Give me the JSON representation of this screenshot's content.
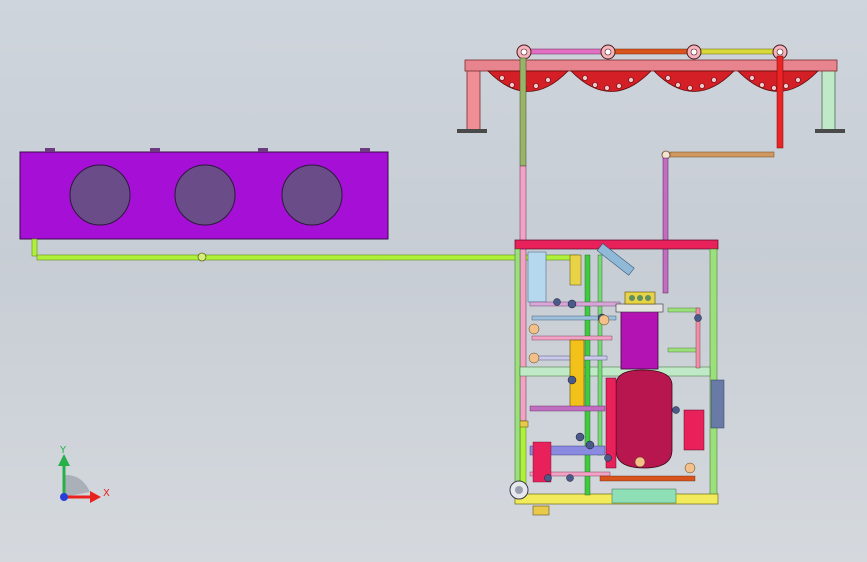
{
  "viewport": {
    "background_top": "#cfd5dc",
    "background_bottom": "#d5d9de"
  },
  "triad": {
    "x_label": "X",
    "y_label": "Y",
    "x_color": "#e8201e",
    "y_color": "#27b04a",
    "z_color": "#2a3fd6"
  },
  "components": {
    "condenser": {
      "body_color": "#a50fd6",
      "fan_color": "#6a4c88",
      "fan_count": 3
    },
    "evaporator_rack": {
      "color": "#d41f26",
      "frame_color": "#e8848d",
      "fan_count": 4
    },
    "skid": {
      "frame_color": "#9be07a",
      "top_color": "#e8215a",
      "base_color": "#f1ea5a"
    },
    "receiver": {
      "color": "#b8164e"
    },
    "compressor": {
      "color": "#b413b4"
    },
    "liquid_line": {
      "color": "#aef13a"
    },
    "suction_line": {
      "color": "#f0a3c4"
    },
    "hot_gas_line": {
      "color": "#c06ec0"
    }
  }
}
